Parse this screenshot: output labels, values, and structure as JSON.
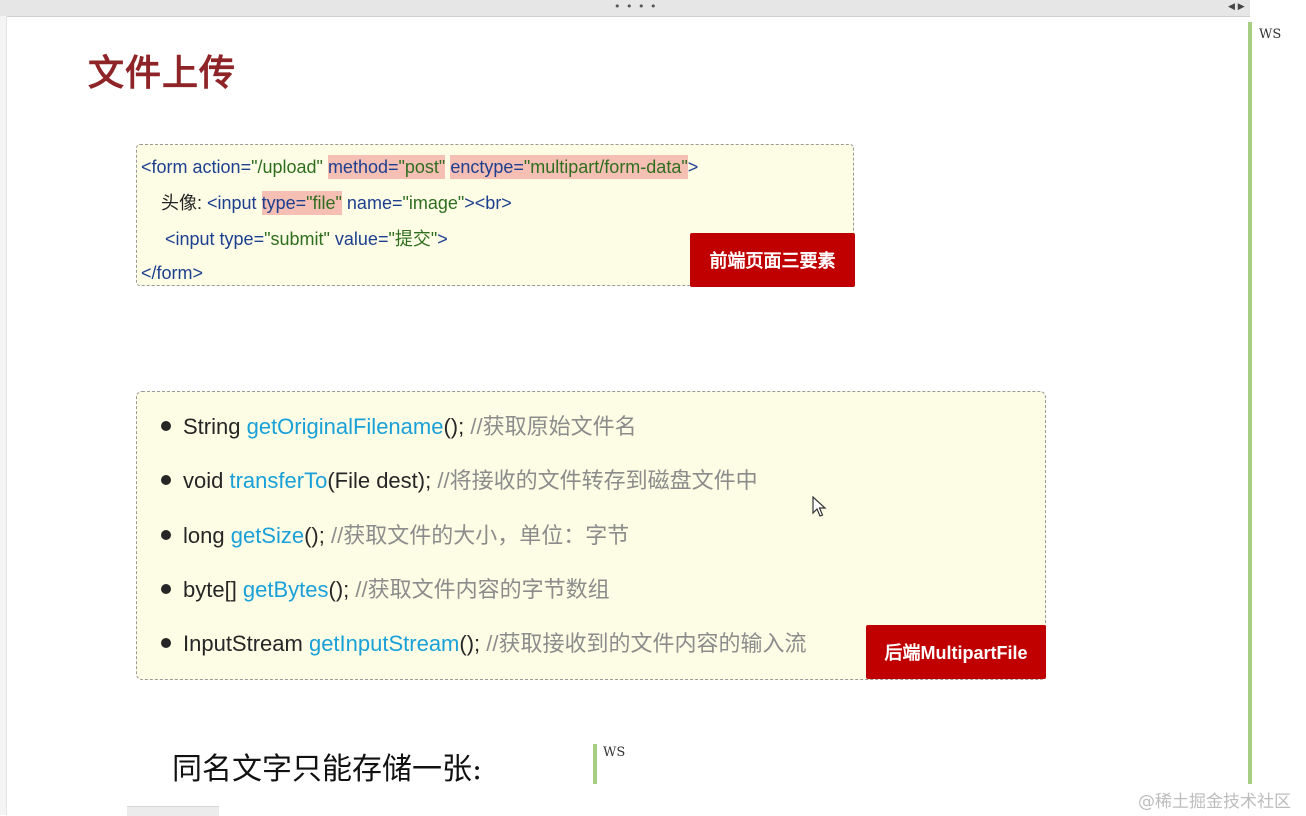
{
  "window": {
    "grip_icon": "drag-grip-dots",
    "nav_arrows_icon": "scroll-arrows",
    "ws_label_right": "WS",
    "ws_label_mid": "WS",
    "watermark": "@稀土掘金技术社区"
  },
  "slide": {
    "title": "文件上传",
    "frontend_box": {
      "line1": {
        "open": "<form ",
        "attr1_name": "action",
        "eq1": "=",
        "attr1_val": "\"/upload\"",
        "space1": " ",
        "attr2_name": "method",
        "eq2": "=",
        "attr2_val": "\"post\"",
        "space2": " ",
        "attr3_name": "enctype",
        "eq3": "=",
        "attr3_val": "\"multipart/form-data\"",
        "close": ">"
      },
      "line2": {
        "label": "头像: ",
        "open": "<input ",
        "attr1_name": "type",
        "eq1": "=",
        "attr1_val": "\"file\"",
        "space1": " ",
        "attr2_name": "name",
        "eq2": "=",
        "attr2_val": "\"image\"",
        "close": "><br>"
      },
      "line3": {
        "open": "<input ",
        "attr1_name": "type",
        "eq1": "=",
        "attr1_val": "\"submit\"",
        "space1": " ",
        "attr2_name": "value",
        "eq2": "=",
        "attr2_val": "\"提交\"",
        "close": ">"
      },
      "line4": "</form>",
      "badge": "前端页面三要素"
    },
    "backend_box": {
      "items": [
        {
          "type": "String ",
          "method": "getOriginalFilename",
          "args": "(); ",
          "comment": "//获取原始文件名"
        },
        {
          "type": "void ",
          "method": "transferTo",
          "args": "(File dest); ",
          "comment": "//将接收的文件转存到磁盘文件中"
        },
        {
          "type": "long ",
          "method": "getSize",
          "args": "(); ",
          "comment": "//获取文件的大小，单位：字节"
        },
        {
          "type": "byte[] ",
          "method": "getBytes",
          "args": "(); ",
          "comment": "//获取文件内容的字节数组"
        },
        {
          "type": "InputStream ",
          "method": "getInputStream",
          "args": "(); ",
          "comment": "//获取接收到的文件内容的输入流"
        }
      ],
      "badge": "后端MultipartFile"
    },
    "note": "同名文字只能存储一张:"
  },
  "colors": {
    "title": "#8e2427",
    "badge": "#c00000",
    "highlight": "#f6bfb4",
    "method": "#1aa0d8",
    "comment": "#8c8c8c",
    "box_bg": "#fdfde5",
    "side_bar": "#a6cf83"
  }
}
